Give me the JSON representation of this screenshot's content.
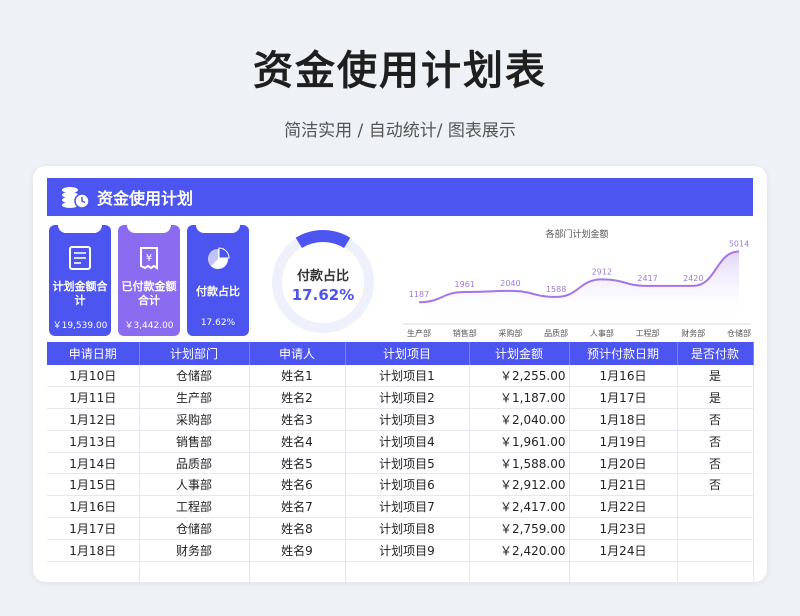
{
  "page": {
    "title": "资金使用计划表",
    "subtitle": "简洁实用 / 自动统计/ 图表展示"
  },
  "banner": {
    "title": "资金使用计划"
  },
  "colors": {
    "accent": "#4c55f0",
    "tile_planned": "#4c55f0",
    "tile_paid": "#8b6cf0",
    "tile_ratio": "#4c55f0",
    "line": "#a574e6"
  },
  "tiles": [
    {
      "icon": "ledger-icon",
      "label": "计划金额合计",
      "value": "￥19,539.00"
    },
    {
      "icon": "receipt-icon",
      "label": "已付款金额合计",
      "value": "￥3,442.00"
    },
    {
      "icon": "pie-icon",
      "label": "付款占比",
      "value": "17.62%"
    }
  ],
  "donut": {
    "label": "付款占比",
    "value": "17.62%",
    "fraction": 0.1762
  },
  "chart_data": {
    "type": "line",
    "title": "各部门计划金额",
    "categories": [
      "生产部",
      "销售部",
      "采购部",
      "品质部",
      "人事部",
      "工程部",
      "财务部",
      "仓储部"
    ],
    "series": [
      {
        "values": [
          1187,
          1961,
          2040,
          1588,
          2912,
          2417,
          2420,
          5014
        ]
      }
    ],
    "data_labels": [
      "1187",
      "1961",
      "2040",
      "1588",
      "2912",
      "2417",
      "2420",
      "5014"
    ],
    "ylim": [
      0,
      5500
    ],
    "grid": false,
    "legend": "none"
  },
  "table": {
    "headers": [
      "申请日期",
      "计划部门",
      "申请人",
      "计划项目",
      "计划金额",
      "预计付款日期",
      "是否付款"
    ],
    "rows": [
      [
        "1月10日",
        "仓储部",
        "姓名1",
        "计划项目1",
        "￥2,255.00",
        "1月16日",
        "是"
      ],
      [
        "1月11日",
        "生产部",
        "姓名2",
        "计划项目2",
        "￥1,187.00",
        "1月17日",
        "是"
      ],
      [
        "1月12日",
        "采购部",
        "姓名3",
        "计划项目3",
        "￥2,040.00",
        "1月18日",
        "否"
      ],
      [
        "1月13日",
        "销售部",
        "姓名4",
        "计划项目4",
        "￥1,961.00",
        "1月19日",
        "否"
      ],
      [
        "1月14日",
        "品质部",
        "姓名5",
        "计划项目5",
        "￥1,588.00",
        "1月20日",
        "否"
      ],
      [
        "1月15日",
        "人事部",
        "姓名6",
        "计划项目6",
        "￥2,912.00",
        "1月21日",
        "否"
      ],
      [
        "1月16日",
        "工程部",
        "姓名7",
        "计划项目7",
        "￥2,417.00",
        "1月22日",
        ""
      ],
      [
        "1月17日",
        "仓储部",
        "姓名8",
        "计划项目8",
        "￥2,759.00",
        "1月23日",
        ""
      ],
      [
        "1月18日",
        "财务部",
        "姓名9",
        "计划项目9",
        "￥2,420.00",
        "1月24日",
        ""
      ],
      [
        "",
        "",
        "",
        "",
        "",
        "",
        ""
      ]
    ]
  }
}
